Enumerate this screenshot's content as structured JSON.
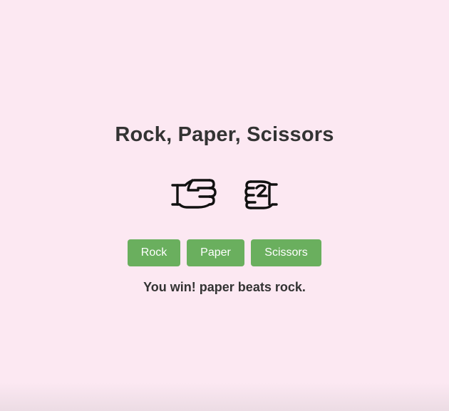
{
  "game": {
    "title": "Rock, Paper, Scissors",
    "player_choice_icon": "paper-hand-icon",
    "computer_choice_icon": "rock-fist-icon",
    "buttons": {
      "rock_label": "Rock",
      "paper_label": "Paper",
      "scissors_label": "Scissors"
    },
    "result_text": "You win! paper beats rock."
  },
  "colors": {
    "background": "#fce8f2",
    "button": "#6aaf5e",
    "text": "#333333"
  }
}
